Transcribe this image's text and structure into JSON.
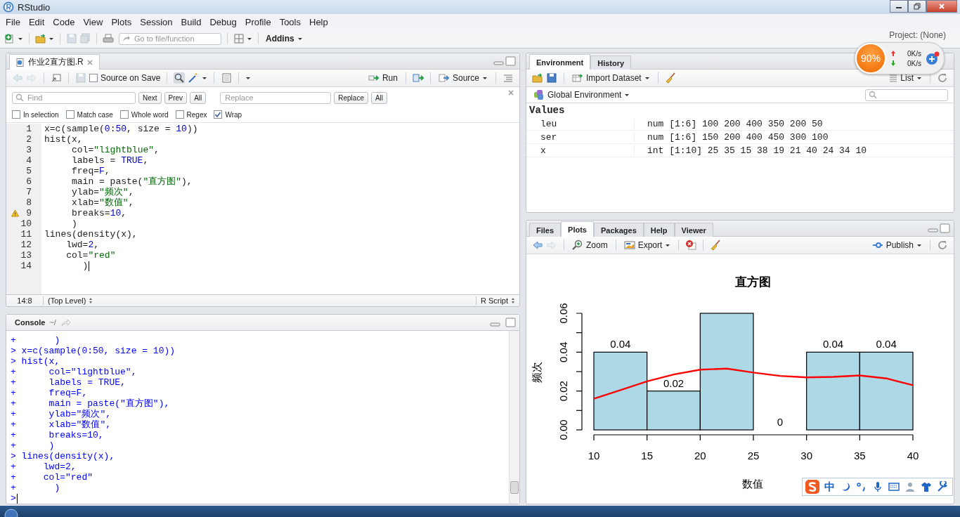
{
  "window": {
    "title": "RStudio"
  },
  "menu": [
    "File",
    "Edit",
    "Code",
    "View",
    "Plots",
    "Session",
    "Build",
    "Debug",
    "Profile",
    "Tools",
    "Help"
  ],
  "toolbar": {
    "goto_placeholder": "Go to file/function",
    "addins": "Addins",
    "project": "Project: (None)"
  },
  "net_widget": {
    "percent": "90%",
    "up": "0K/s",
    "down": "0K/s"
  },
  "source": {
    "tabs": [
      {
        "label": "作业2直方图.R",
        "selected": true
      }
    ],
    "source_on_save": {
      "label": "Source on Save",
      "checked": false
    },
    "run": "Run",
    "source_button": "Source",
    "find": {
      "find_placeholder": "Find",
      "next": "Next",
      "prev": "Prev",
      "all": "All",
      "replace_placeholder": "Replace",
      "replace": "Replace",
      "replace_all": "All"
    },
    "options": [
      {
        "label": "In selection",
        "checked": false
      },
      {
        "label": "Match case",
        "checked": false
      },
      {
        "label": "Whole word",
        "checked": false
      },
      {
        "label": "Regex",
        "checked": false
      },
      {
        "label": "Wrap",
        "checked": true
      }
    ],
    "lines": [
      {
        "number": "1",
        "code": "x=c(sample(0:50, size = 10))",
        "warning": false,
        "cursor": false
      },
      {
        "number": "2",
        "code": "hist(x,",
        "warning": false,
        "cursor": false
      },
      {
        "number": "3",
        "code": "     col=\"lightblue\",",
        "warning": false,
        "cursor": false
      },
      {
        "number": "4",
        "code": "     labels = TRUE,",
        "warning": false,
        "cursor": false
      },
      {
        "number": "5",
        "code": "     freq=F,",
        "warning": false,
        "cursor": false
      },
      {
        "number": "6",
        "code": "     main = paste(\"直方图\"),",
        "warning": false,
        "cursor": false
      },
      {
        "number": "7",
        "code": "     ylab=\"频次\",",
        "warning": false,
        "cursor": false
      },
      {
        "number": "8",
        "code": "     xlab=\"数值\",",
        "warning": false,
        "cursor": false
      },
      {
        "number": "9",
        "code": "     breaks=10,",
        "warning": true,
        "cursor": false
      },
      {
        "number": "10",
        "code": "     )",
        "warning": false,
        "cursor": false
      },
      {
        "number": "11",
        "code": "lines(density(x),",
        "warning": false,
        "cursor": false
      },
      {
        "number": "12",
        "code": "    lwd=2,",
        "warning": false,
        "cursor": false
      },
      {
        "number": "13",
        "code": "    col=\"red\"",
        "warning": false,
        "cursor": false
      },
      {
        "number": "14",
        "code": "       )",
        "warning": false,
        "cursor": true
      }
    ],
    "status": {
      "position": "14:8",
      "scope": "(Top Level)",
      "type": "R Script"
    }
  },
  "console": {
    "title": "Console",
    "path": "~/",
    "lines": [
      "+       )",
      "> x=c(sample(0:50, size = 10))",
      "> hist(x,",
      "+      col=\"lightblue\",",
      "+      labels = TRUE,",
      "+      freq=F,",
      "+      main = paste(\"直方图\"),",
      "+      ylab=\"频次\",",
      "+      xlab=\"数值\",",
      "+      breaks=10,",
      "+      )",
      "> lines(density(x),",
      "+     lwd=2,",
      "+     col=\"red\"",
      "+       )"
    ],
    "prompt": ">"
  },
  "environment": {
    "tabs": [
      {
        "label": "Environment",
        "selected": true
      },
      {
        "label": "History",
        "selected": false
      }
    ],
    "import": "Import Dataset",
    "view": "List",
    "scope": "Global Environment",
    "section": "Values",
    "rows": [
      {
        "name": "leu",
        "value": "num [1:6] 100 200 400 350 200 50"
      },
      {
        "name": "ser",
        "value": "num [1:6] 150 200 400 450 300 100"
      },
      {
        "name": "x",
        "value": "int [1:10] 25 35 15 38 19 21 40 24 34 10"
      }
    ]
  },
  "plots_pane": {
    "tabs": [
      {
        "label": "Files",
        "selected": false
      },
      {
        "label": "Plots",
        "selected": true
      },
      {
        "label": "Packages",
        "selected": false
      },
      {
        "label": "Help",
        "selected": false
      },
      {
        "label": "Viewer",
        "selected": false
      }
    ],
    "zoom": "Zoom",
    "export": "Export",
    "publish": "Publish",
    "chart_data": {
      "type": "bar",
      "title": "直方图",
      "xlabel": "数值",
      "ylabel": "频次",
      "x": [
        10,
        12.5,
        15,
        17.5,
        20,
        22.5,
        25,
        27.5,
        30,
        32.5,
        35,
        37.5,
        40
      ],
      "series": [
        {
          "color": "#add8e6",
          "values": [
            null,
            0.04,
            null,
            0.02,
            null,
            0.06,
            null,
            0,
            null,
            0.04,
            null,
            0.04,
            null
          ]
        },
        {
          "type": "line",
          "color": "#ff0000",
          "values": [
            0.016,
            0.0205,
            0.025,
            0.0285,
            0.031,
            0.0315,
            0.0295,
            0.0278,
            0.027,
            0.0273,
            0.028,
            0.0265,
            0.023
          ]
        }
      ],
      "xlim": [
        10,
        40
      ],
      "ylim": [
        0,
        0.06
      ],
      "xticks": [
        10,
        15,
        20,
        25,
        30,
        35,
        40
      ],
      "yticks": [
        {
          "value": 0,
          "label": "0.00"
        },
        {
          "value": 0.02,
          "label": "0.02"
        },
        {
          "value": 0.04,
          "label": "0.04"
        },
        {
          "value": 0.06,
          "label": "0.06"
        }
      ],
      "value_labels": [
        null,
        "0.04",
        null,
        "0.02",
        null,
        null,
        null,
        "0",
        null,
        "0.04",
        null,
        "0.04",
        null
      ]
    }
  },
  "ime_bar": {
    "label": "中"
  }
}
